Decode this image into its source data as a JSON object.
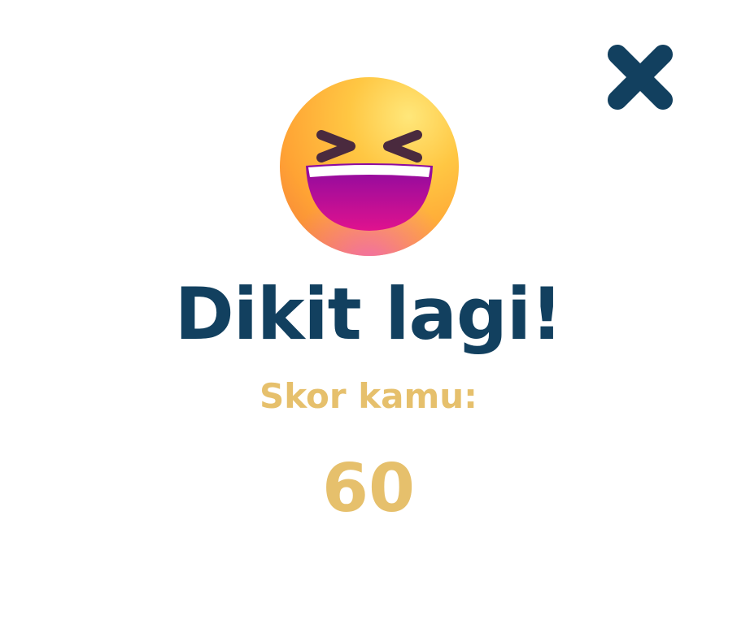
{
  "dialog": {
    "title": "Dikit lagi!",
    "score_label": "Skor kamu:",
    "score_value": "60",
    "close_icon": "close-icon",
    "emoji_icon": "grinning-squinting-face-icon"
  },
  "colors": {
    "title": "#12405f",
    "accent": "#e6c06c",
    "close": "#12405f",
    "background": "#ffffff"
  }
}
